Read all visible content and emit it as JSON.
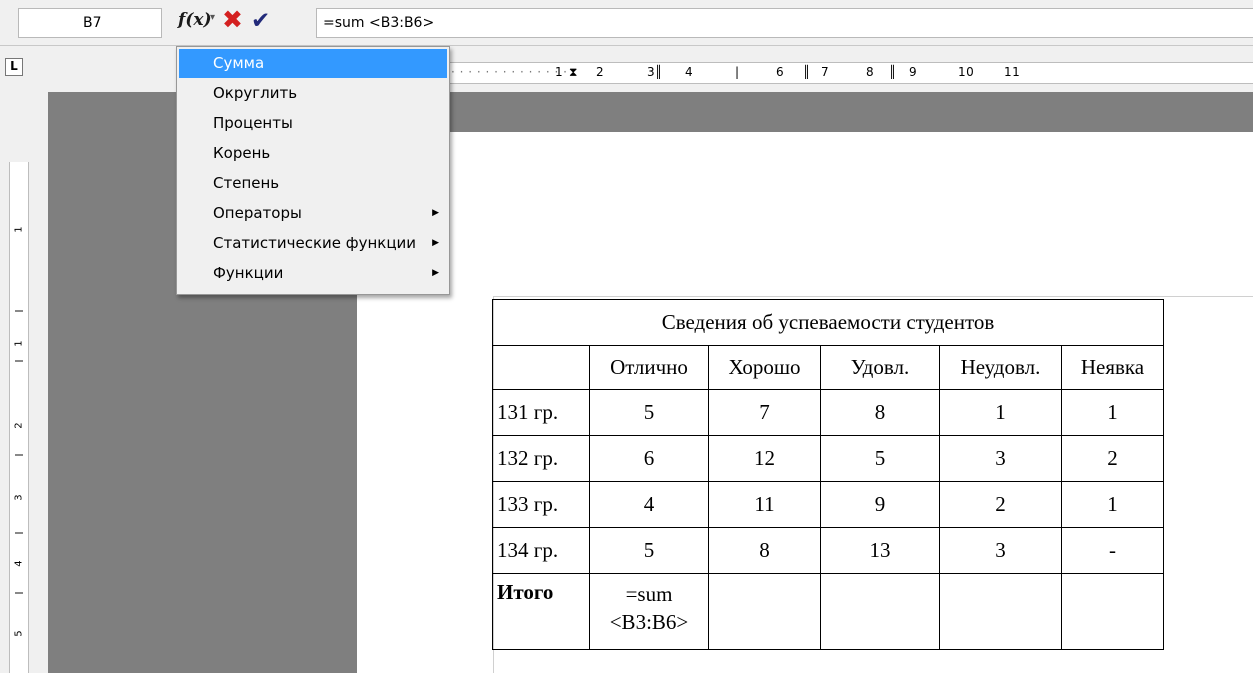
{
  "formula_bar": {
    "cell_ref": "B7",
    "fx_label": "f(x)",
    "formula_text": "=sum <B3:B6>",
    "icons": [
      "function-icon",
      "dropdown-arrow-icon",
      "cancel-icon",
      "accept-icon"
    ],
    "colors": {
      "cancel": "#d42020",
      "accept": "#222a7a"
    }
  },
  "ruler": {
    "tab_selector": "L",
    "horizontal_numbers": [
      "1",
      "2",
      "3",
      "4",
      "6",
      "7",
      "8",
      "9",
      "10",
      "11"
    ],
    "vertical_numbers": [
      "1",
      "1",
      "2",
      "3",
      "4",
      "5"
    ]
  },
  "menu": {
    "selected_color": "#3399ff",
    "items": [
      {
        "label": "Сумма",
        "has_submenu": false,
        "selected": true
      },
      {
        "label": "Округлить",
        "has_submenu": false,
        "selected": false
      },
      {
        "label": "Проценты",
        "has_submenu": false,
        "selected": false
      },
      {
        "label": "Корень",
        "has_submenu": false,
        "selected": false
      },
      {
        "label": "Степень",
        "has_submenu": false,
        "selected": false
      },
      {
        "label": "Операторы",
        "has_submenu": true,
        "selected": false
      },
      {
        "label": "Статистические функции",
        "has_submenu": true,
        "selected": false
      },
      {
        "label": "Функции",
        "has_submenu": true,
        "selected": false
      }
    ]
  },
  "table": {
    "title": "Сведения об успеваемости студентов",
    "headers": [
      "",
      "Отлично",
      "Хорошо",
      "Удовл.",
      "Неудовл.",
      "Неявка"
    ],
    "rows": [
      [
        "131 гр.",
        "5",
        "7",
        "8",
        "1",
        "1"
      ],
      [
        "132 гр.",
        "6",
        "12",
        "5",
        "3",
        "2"
      ],
      [
        "133 гр.",
        "4",
        "11",
        "9",
        "2",
        "1"
      ],
      [
        "134 гр.",
        "5",
        "8",
        "13",
        "3",
        "-"
      ]
    ],
    "total_row": {
      "label": "Итого",
      "formula_line1": "=sum",
      "formula_line2": "<B3:B6>"
    }
  }
}
